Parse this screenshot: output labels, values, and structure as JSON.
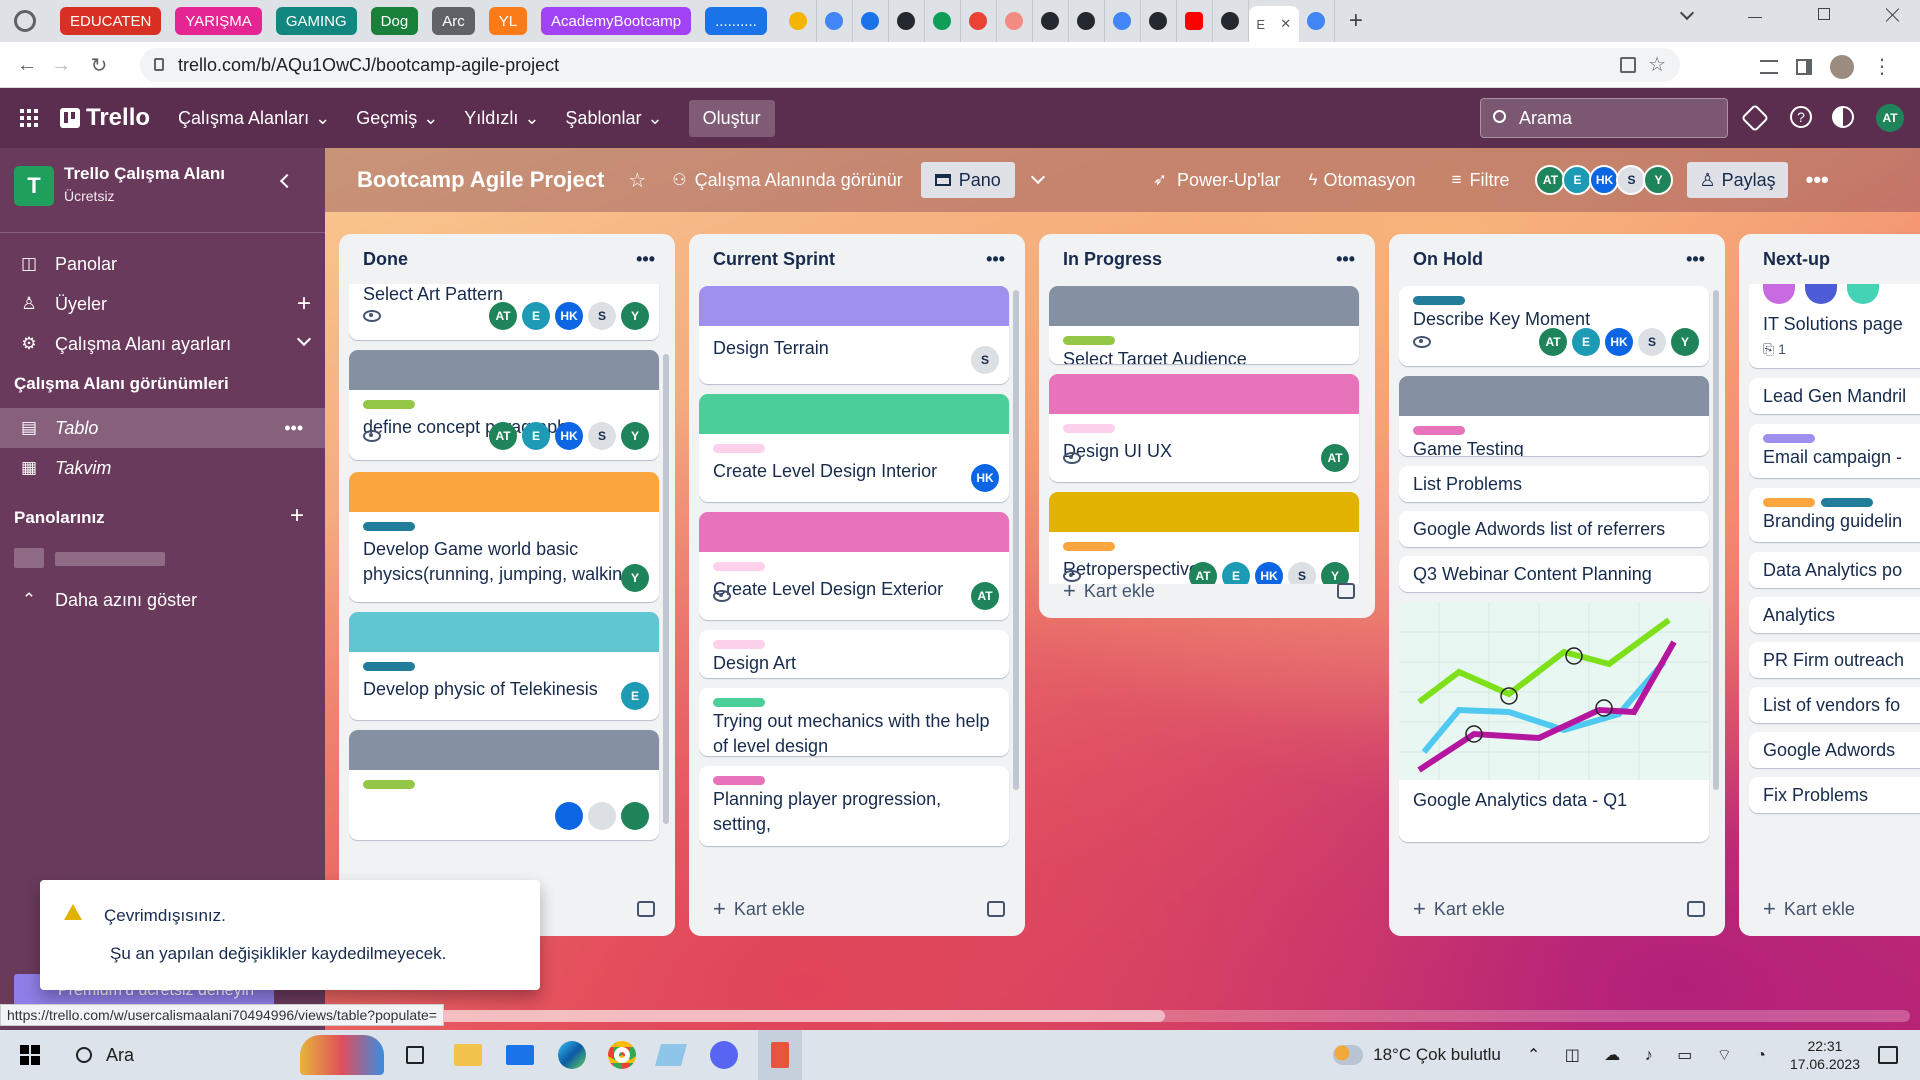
{
  "browser": {
    "tabs": [
      {
        "label": "EDUCATEN",
        "color": "#d93025"
      },
      {
        "label": "YARIŞMA",
        "color": "#e52592"
      },
      {
        "label": "GAMING",
        "color": "#12877f"
      },
      {
        "label": "Dog",
        "color": "#188038"
      },
      {
        "label": "Arc",
        "color": "#5f6368"
      },
      {
        "label": "YL",
        "color": "#fa7b17"
      },
      {
        "label": "AcademyBootcamp",
        "color": "#a142f4"
      },
      {
        "label": "..........",
        "color": "#1a73e8"
      }
    ],
    "active_tab_char": "E",
    "close_glyph": "✕",
    "new_tab_glyph": "+",
    "url": "trello.com/b/AQu1OwCJ/bootcamp-agile-project",
    "status_url": "https://trello.com/w/usercalismaalani70494996/views/table?populate="
  },
  "header": {
    "logo": "Trello",
    "menus": [
      "Çalışma Alanları",
      "Geçmiş",
      "Yıldızlı",
      "Şablonlar"
    ],
    "create": "Oluştur",
    "search_placeholder": "Arama",
    "user": "AT"
  },
  "sidebar": {
    "workspace_letter": "T",
    "workspace_name": "Trello Çalışma Alanı",
    "workspace_plan": "Ücretsiz",
    "items": [
      "Panolar",
      "Üyeler",
      "Çalışma Alanı ayarları"
    ],
    "views_title": "Çalışma Alanı görünümleri",
    "views": [
      "Tablo",
      "Takvim"
    ],
    "boards_title": "Panolarınız",
    "show_less": "Daha azını göster",
    "premium": "Premium'u ücretsiz deneyin"
  },
  "board": {
    "title": "Bootcamp Agile Project",
    "visibility": "Çalışma Alanında görünür",
    "view": "Pano",
    "powerups": "Power-Up'lar",
    "automation": "Otomasyon",
    "filter": "Filtre",
    "share": "Paylaş",
    "members": [
      "AT",
      "E",
      "HK",
      "S",
      "Y"
    ],
    "add_card": "Kart ekle"
  },
  "lists": [
    {
      "title": "Done",
      "cards": [
        {
          "title": "Select Art Pattern",
          "members": [
            "AT",
            "E",
            "HK",
            "S",
            "Y"
          ]
        },
        {
          "title": "define concept paragraph",
          "members": [
            "AT",
            "E",
            "HK",
            "S",
            "Y"
          ]
        },
        {
          "title": "Develop Game world basic physics(running, jumping, walking)",
          "members": [
            "Y"
          ]
        },
        {
          "title": "Develop physic of Telekinesis",
          "members": [
            "E"
          ]
        }
      ]
    },
    {
      "title": "Current Sprint",
      "cards": [
        {
          "title": "Design Terrain",
          "members": [
            "S"
          ]
        },
        {
          "title": "Create Level Design Interior",
          "members": [
            "HK"
          ]
        },
        {
          "title": "Create Level Design Exterior",
          "members": [
            "AT"
          ]
        },
        {
          "title": "Design Art"
        },
        {
          "title": "Trying out mechanics with the help of level design"
        },
        {
          "title": "Planning player progression, setting,"
        }
      ]
    },
    {
      "title": "In Progress",
      "cards": [
        {
          "title": "Select Target Audience"
        },
        {
          "title": "Design UI UX",
          "members": [
            "AT"
          ]
        },
        {
          "title": "Retroperspective",
          "members": [
            "AT",
            "E",
            "HK",
            "S",
            "Y"
          ]
        }
      ]
    },
    {
      "title": "On Hold",
      "cards": [
        {
          "title": "Describe Key Moment",
          "members": [
            "AT",
            "E",
            "HK",
            "S",
            "Y"
          ]
        },
        {
          "title": "Game Testing"
        },
        {
          "title": "List Problems"
        },
        {
          "title": "Google Adwords list of referrers"
        },
        {
          "title": "Q3 Webinar Content Planning"
        },
        {
          "title": "Google Analytics data - Q1"
        }
      ]
    },
    {
      "title": "Next-up",
      "cards": [
        {
          "title": "IT Solutions page",
          "attachments": "1"
        },
        {
          "title": "Lead Gen Mandril"
        },
        {
          "title": "Email campaign -"
        },
        {
          "title": "Branding guidelin"
        },
        {
          "title": "Data Analytics po"
        },
        {
          "title": "Analytics"
        },
        {
          "title": "PR Firm outreach"
        },
        {
          "title": "List of vendors fo"
        },
        {
          "title": "Google Adwords"
        },
        {
          "title": "Fix Problems"
        }
      ]
    }
  ],
  "toast": {
    "title": "Çevrimdışısınız.",
    "message": "Şu an yapılan değişiklikler kaydedilmeyecek."
  },
  "taskbar": {
    "search": "Ara",
    "weather": "18°C  Çok bulutlu",
    "time": "22:31",
    "date": "17.06.2023"
  },
  "colors": {
    "header": "#5b2e4f",
    "sidebar": "#6a3a5c",
    "accent_green": "#1f845a"
  }
}
